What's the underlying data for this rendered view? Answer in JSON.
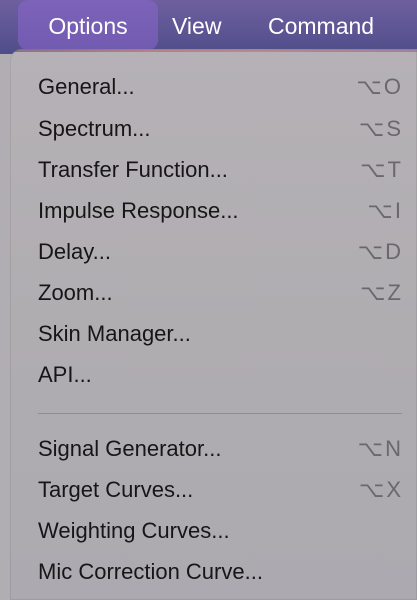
{
  "menubar": {
    "items": [
      {
        "label": "Options",
        "active": true
      },
      {
        "label": "View"
      },
      {
        "label": "Command"
      }
    ]
  },
  "menu": {
    "items": [
      {
        "label": "General...",
        "shortcut": "⌥O"
      },
      {
        "label": "Spectrum...",
        "shortcut": "⌥S"
      },
      {
        "label": "Transfer Function...",
        "shortcut": "⌥T"
      },
      {
        "label": "Impulse Response...",
        "shortcut": "⌥I"
      },
      {
        "label": "Delay...",
        "shortcut": "⌥D"
      },
      {
        "label": "Zoom...",
        "shortcut": "⌥Z"
      },
      {
        "label": "Skin Manager...",
        "shortcut": ""
      },
      {
        "label": "API...",
        "shortcut": ""
      },
      {
        "label": "Signal Generator...",
        "shortcut": "⌥N"
      },
      {
        "label": "Target Curves...",
        "shortcut": "⌥X"
      },
      {
        "label": "Weighting Curves...",
        "shortcut": ""
      },
      {
        "label": "Mic Correction Curve...",
        "shortcut": ""
      }
    ]
  },
  "colors": {
    "menubar_bg": "#5d5593",
    "menubar_active": "#7a62b6",
    "dropdown_bg": "#b1aeb3",
    "text": "#161616",
    "shortcut_text": "#6a686c"
  }
}
